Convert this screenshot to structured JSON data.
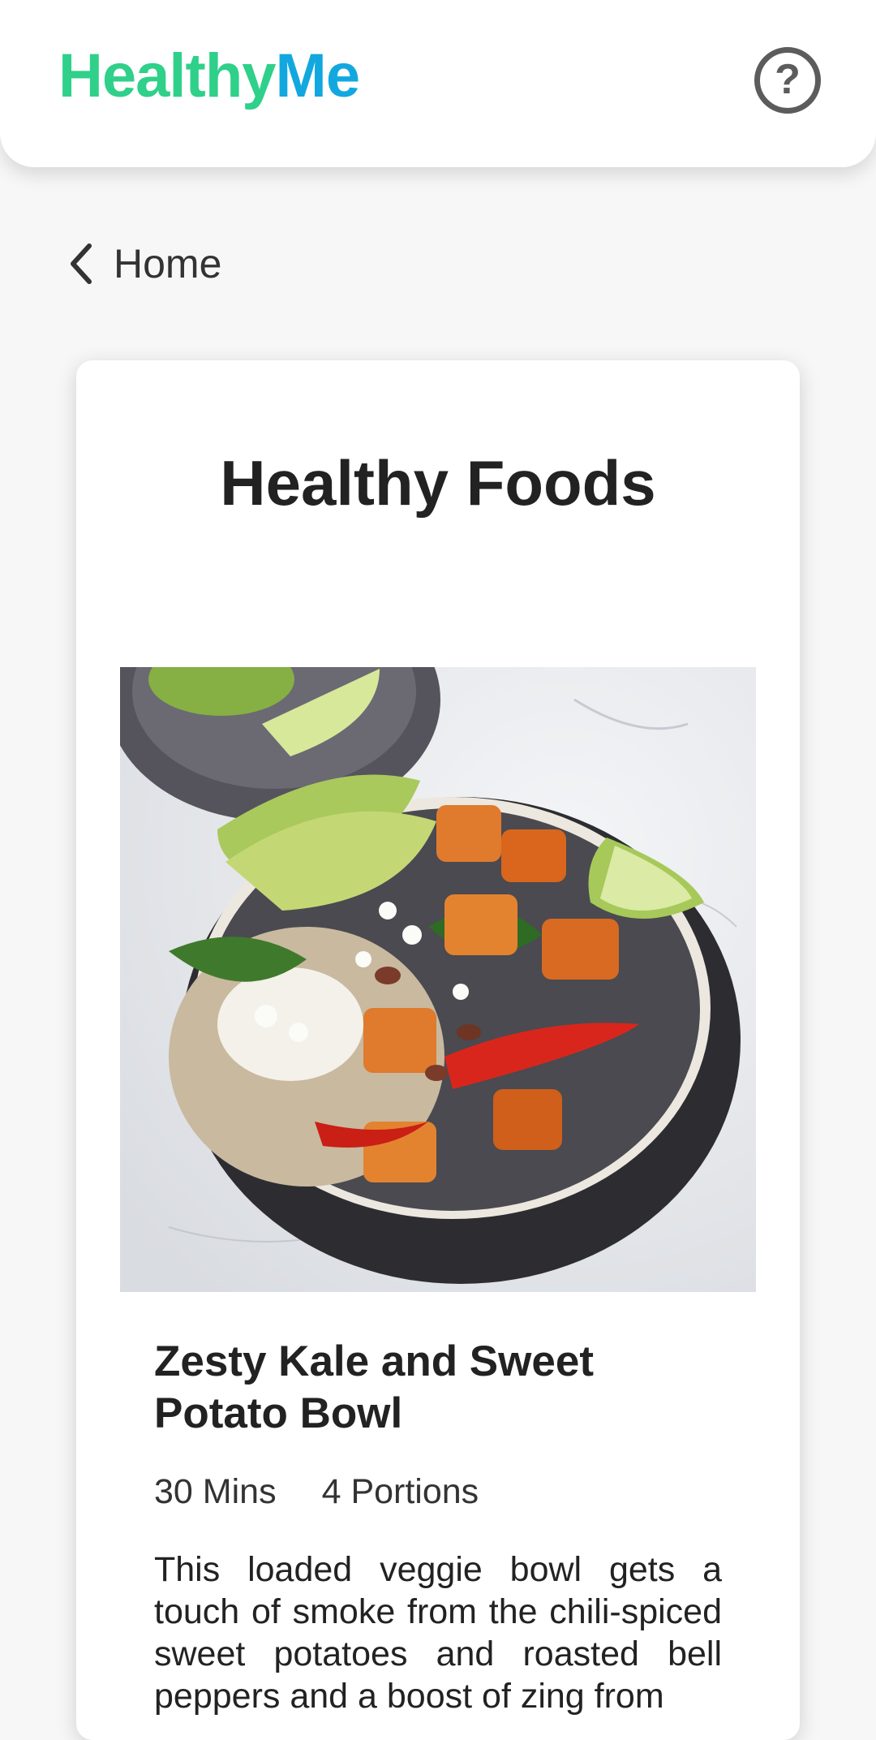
{
  "header": {
    "logo_part1": "Healthy",
    "logo_part2": "Me",
    "help_symbol": "?",
    "help_icon": "question-circle-icon"
  },
  "nav": {
    "back_label": "Home",
    "back_icon": "chevron-left-icon"
  },
  "card": {
    "title": "Healthy Foods",
    "food": {
      "name": "Zesty Kale and Sweet Potato Bowl",
      "time": "30 Mins",
      "portions": "4 Portions",
      "description": "This loaded veggie bowl gets a touch of smoke from the chili-spiced sweet potatoes and roasted bell peppers and a boost of zing from"
    }
  },
  "colors": {
    "logo_green": "#2fd08a",
    "logo_blue": "#12a8df"
  }
}
